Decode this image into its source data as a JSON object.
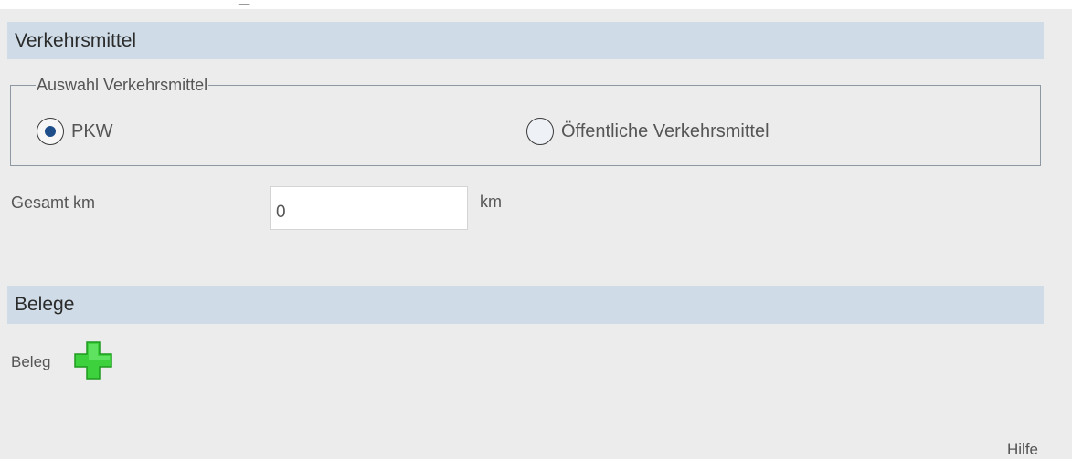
{
  "sections": {
    "transport": {
      "title": "Verkehrsmittel",
      "group_label": "Auswahl Verkehrsmittel",
      "options": [
        {
          "label": "PKW",
          "selected": true
        },
        {
          "label": "Öffentliche Verkehrsmittel",
          "selected": false
        }
      ]
    },
    "distance": {
      "label": "Gesamt km",
      "value": "0",
      "unit": "km"
    },
    "receipts": {
      "title": "Belege",
      "item_label": "Beleg",
      "add_icon": "plus-icon"
    }
  },
  "footer": {
    "help_label": "Hilfe"
  },
  "colors": {
    "background": "#ececec",
    "header_bg": "#cfdce7",
    "radio_selected": "#1f4f8a",
    "add_icon_fill": "#3dd13d"
  }
}
